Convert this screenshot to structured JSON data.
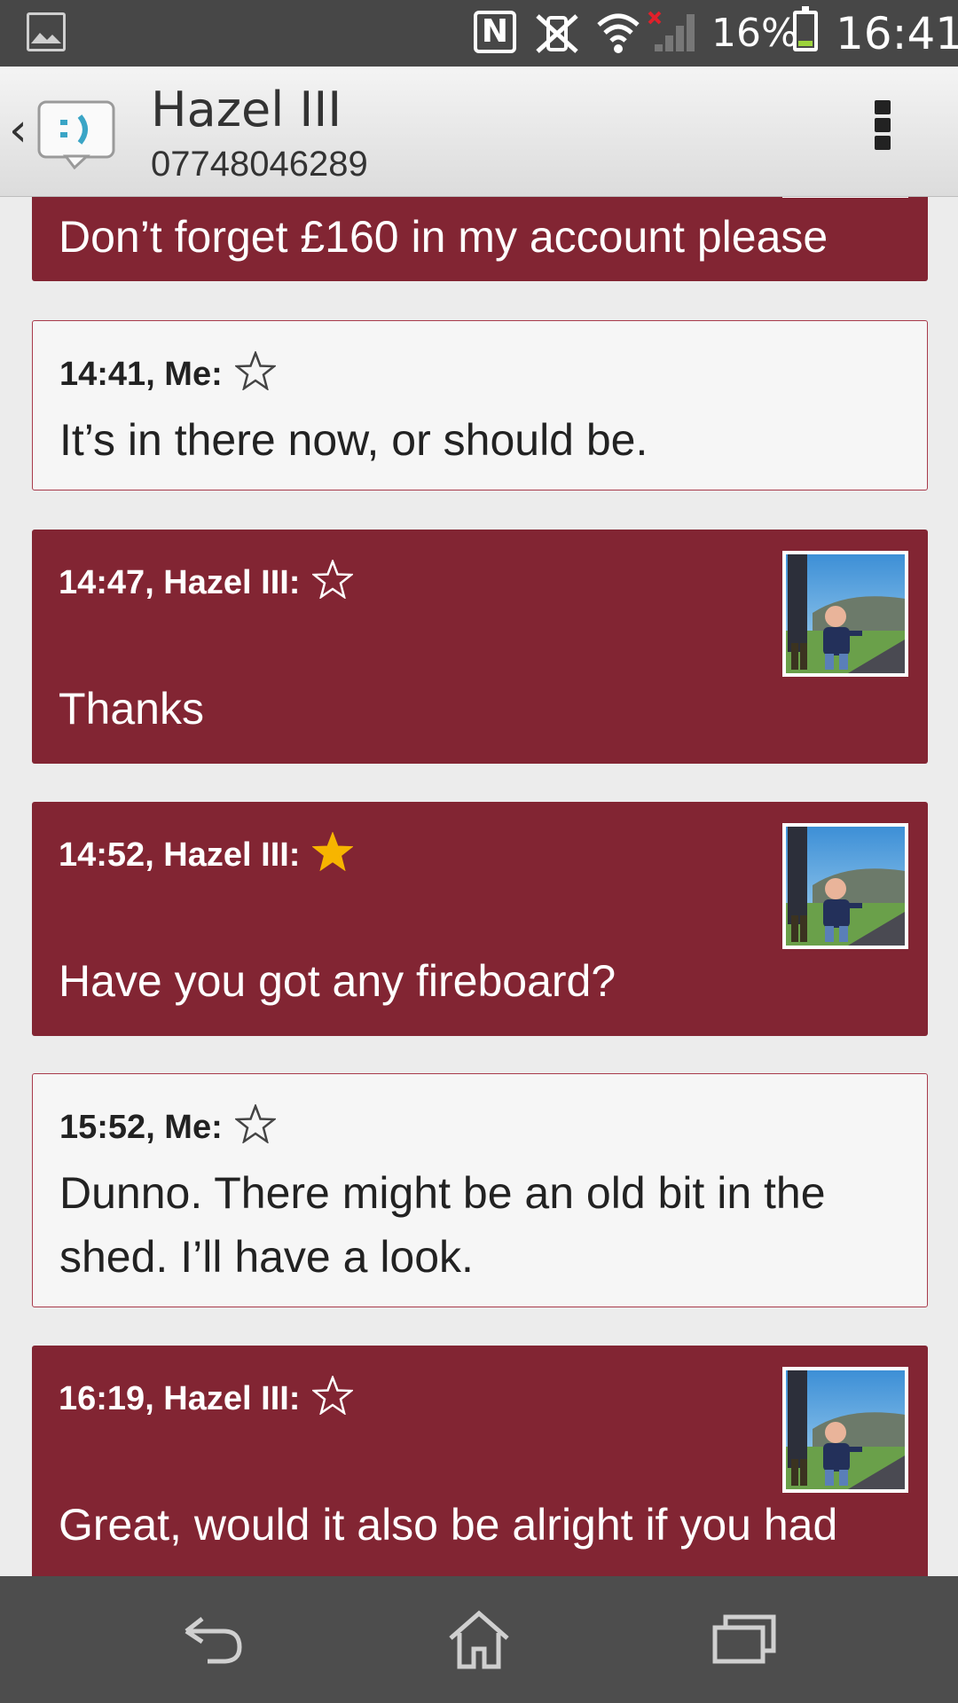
{
  "status_bar": {
    "icons": [
      "gallery-icon",
      "nfc-icon",
      "vibrate-mute-icon",
      "wifi-icon",
      "signal-icon",
      "battery-icon"
    ],
    "nfc_glyph": "N",
    "battery_percent": "16%",
    "battery_level": 0.16,
    "time": "16:41"
  },
  "header": {
    "contact_name": "Hazel III",
    "contact_number": "07748046289",
    "icons": [
      "back-chevron-icon",
      "messaging-app-icon",
      "overflow-menu-icon"
    ]
  },
  "colors": {
    "incoming_bubble": "#822533",
    "outgoing_bubble": "#f6f6f6",
    "starred": "#f7b500"
  },
  "messages": [
    {
      "time_sender": "",
      "text": "Don’t forget £160 in my account please",
      "direction": "in",
      "starred": false,
      "has_avatar": true
    },
    {
      "time_sender": "14:41, Me:",
      "text": "It’s in there now, or should be.",
      "direction": "out",
      "starred": false,
      "has_avatar": false
    },
    {
      "time_sender": "14:47, Hazel III:",
      "text": "Thanks",
      "direction": "in",
      "starred": false,
      "has_avatar": true
    },
    {
      "time_sender": "14:52, Hazel III:",
      "text": "Have you got any fireboard?",
      "direction": "in",
      "starred": true,
      "has_avatar": true
    },
    {
      "time_sender": "15:52, Me:",
      "text": "Dunno. There might be an old bit in the shed.  I’ll have a look.",
      "direction": "out",
      "starred": false,
      "has_avatar": false
    },
    {
      "time_sender": "16:19, Hazel III:",
      "text": "Great, would it also be alright if you had",
      "direction": "in",
      "starred": false,
      "has_avatar": true
    }
  ],
  "nav_bar": {
    "buttons": [
      "back-icon",
      "home-icon",
      "recent-apps-icon"
    ]
  }
}
